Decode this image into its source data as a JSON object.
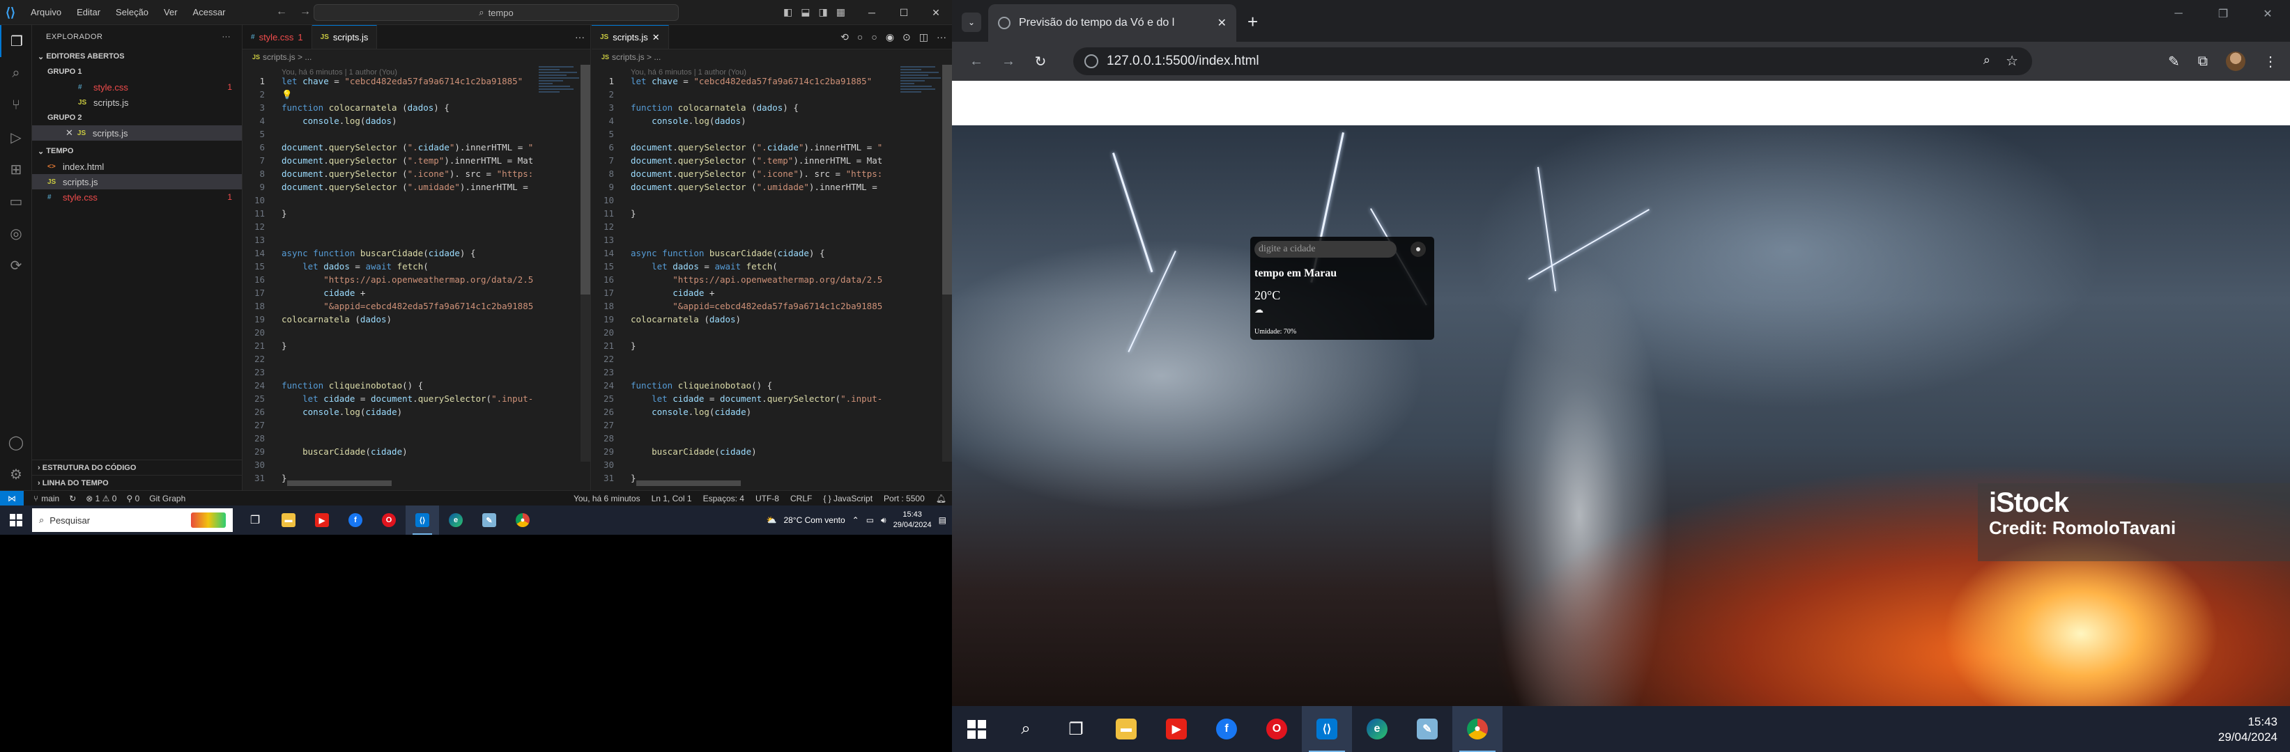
{
  "vscode": {
    "menu": [
      "Arquivo",
      "Editar",
      "Seleção",
      "Ver",
      "Acessar"
    ],
    "command_center": "tempo",
    "explorer_title": "EXPLORADOR",
    "open_editors_label": "EDITORES ABERTOS",
    "groups": [
      {
        "label": "GRUPO 1",
        "files": [
          {
            "name": "style.css",
            "type": "css",
            "badge": "1"
          },
          {
            "name": "scripts.js",
            "type": "js",
            "badge": ""
          }
        ]
      },
      {
        "label": "GRUPO 2",
        "files": [
          {
            "name": "scripts.js",
            "type": "js",
            "badge": ""
          }
        ]
      }
    ],
    "folder_label": "TEMPO",
    "folder_files": [
      {
        "name": "index.html",
        "type": "html",
        "badge": ""
      },
      {
        "name": "scripts.js",
        "type": "js",
        "badge": ""
      },
      {
        "name": "style.css",
        "type": "css",
        "badge": "1"
      }
    ],
    "outline_label": "ESTRUTURA DO CÓDIGO",
    "timeline_label": "LINHA DO TEMPO",
    "editor1": {
      "tabs": [
        {
          "name": "style.css",
          "badge": "1"
        },
        {
          "name": "scripts.js",
          "badge": ""
        }
      ],
      "breadcrumb": "scripts.js > ..."
    },
    "editor2": {
      "tabs": [
        {
          "name": "scripts.js",
          "badge": ""
        }
      ],
      "breadcrumb": "scripts.js > ..."
    },
    "blame": "You, há 6 minutos | 1 author (You)",
    "code_lines_1": [
      "let chave = \"cebcd482eda57fa9a6714c1c2ba91885\"",
      "💡",
      "function colocarnatela (dados) {",
      "    console.log(dados)",
      "",
      "document.querySelector (\".cidade\").innerHTML = \"",
      "document.querySelector (\".temp\").innerHTML = Mat",
      "document.querySelector (\".icone\"). src = \"https:",
      "document.querySelector (\".umidade\").innerHTML =",
      "",
      "}",
      "",
      "",
      "async function buscarCidade(cidade) {",
      "    let dados = await fetch(",
      "        \"https://api.openweathermap.org/data/2.5",
      "        cidade +",
      "        \"&appid=cebcd482eda57fa9a6714c1c2ba91885",
      "colocarnatela (dados)",
      "",
      "}",
      "",
      "",
      "function cliqueinobotao() {",
      "    let cidade = document.querySelector(\".input-",
      "    console.log(cidade)",
      "",
      "",
      "    buscarCidade(cidade)",
      "",
      "}"
    ],
    "code_lines_2": [
      "let chave = \"cebcd482eda57fa9a6714c1c2ba91885\"",
      "",
      "function colocarnatela (dados) {",
      "    console.log(dados)",
      "",
      "document.querySelector (\".cidade\").innerHTML = \"",
      "document.querySelector (\".temp\").innerHTML = Mat",
      "document.querySelector (\".icone\"). src = \"https:",
      "document.querySelector (\".umidade\").innerHTML =",
      "",
      "}",
      "",
      "",
      "async function buscarCidade(cidade) {",
      "    let dados = await fetch(",
      "        \"https://api.openweathermap.org/data/2.5",
      "        cidade +",
      "        \"&appid=cebcd482eda57fa9a6714c1c2ba91885",
      "colocarnatela (dados)",
      "",
      "}",
      "",
      "",
      "function cliqueinobotao() {",
      "    let cidade = document.querySelector(\".input-",
      "    console.log(cidade)",
      "",
      "",
      "    buscarCidade(cidade)",
      "",
      "}"
    ],
    "status": {
      "branch": "main",
      "sync": "↻",
      "problems": "⊗ 1 ⚠ 0",
      "ports": "⚲ 0",
      "git_graph": "Git Graph",
      "blame": "You, há 6 minutos",
      "position": "Ln 1, Col 1",
      "spaces": "Espaços: 4",
      "encoding": "UTF-8",
      "eol": "CRLF",
      "language": "{ } JavaScript",
      "port": "Port : 5500"
    },
    "taskbar": {
      "search_placeholder": "Pesquisar",
      "weather": "28°C  Com vento",
      "time": "15:43",
      "date": "29/04/2024"
    }
  },
  "browser": {
    "tab_title": "Previsão do tempo da Vó e do l",
    "url": "127.0.0.1:5500/index.html",
    "card": {
      "input_placeholder": "digite a cidade",
      "city": "tempo em Marau",
      "temp": "20°C",
      "icon": "☁",
      "humidity": "Umidade: 70%"
    },
    "watermark": {
      "brand": "iStock",
      "credit": "Credit: RomoloTavani"
    },
    "taskbar": {
      "time": "15:43",
      "date": "29/04/2024"
    }
  },
  "colors": {
    "accent": "#0078d4",
    "error": "#f14c4c",
    "js": "#cbcb41",
    "css": "#519aba",
    "html": "#e37933"
  }
}
